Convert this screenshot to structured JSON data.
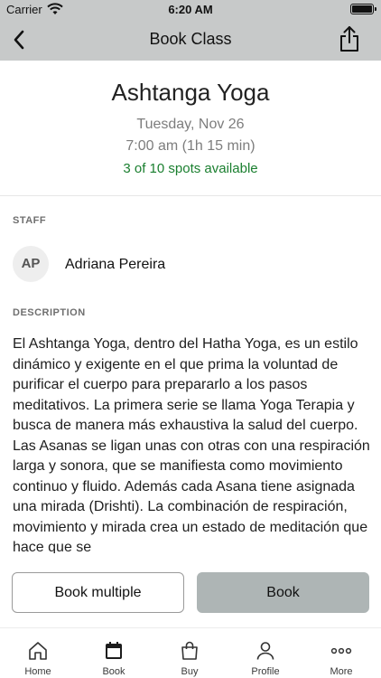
{
  "status_bar": {
    "carrier": "Carrier",
    "time": "6:20 AM"
  },
  "nav": {
    "title": "Book Class",
    "back_icon": "chevron-left-icon",
    "share_icon": "share-icon"
  },
  "class_info": {
    "name": "Ashtanga Yoga",
    "date": "Tuesday, Nov 26",
    "time": "7:00 am (1h 15 min)",
    "spots": "3 of 10 spots available",
    "spots_color": "#1a7f2f"
  },
  "staff": {
    "section_label": "STAFF",
    "initials": "AP",
    "name": "Adriana Pereira"
  },
  "description": {
    "section_label": "DESCRIPTION",
    "text": "El Ashtanga Yoga, dentro del Hatha Yoga, es un estilo dinámico y exigente en el que prima la voluntad de purificar el cuerpo para prepararlo a los pasos meditativos. La primera serie se llama Yoga Terapia y busca de manera más exhaustiva la salud del cuerpo. Las Asanas se ligan unas con otras con una respiración larga y sonora, que se manifiesta como movimiento continuo y fluido. Además cada Asana tiene asignada una mirada (Drishti). La combinación de respiración, movimiento y mirada crea un estado de meditación que hace que se"
  },
  "actions": {
    "book_multiple_label": "Book multiple",
    "book_label": "Book"
  },
  "tabbar": {
    "tabs": [
      {
        "label": "Home",
        "icon": "home-icon"
      },
      {
        "label": "Book",
        "icon": "calendar-icon",
        "selected": true
      },
      {
        "label": "Buy",
        "icon": "shopping-bag-icon"
      },
      {
        "label": "Profile",
        "icon": "person-icon"
      },
      {
        "label": "More",
        "icon": "more-dots-icon"
      }
    ]
  },
  "colors": {
    "header_bg": "#c7c9c9",
    "primary_button_bg": "#aeb5b5"
  }
}
